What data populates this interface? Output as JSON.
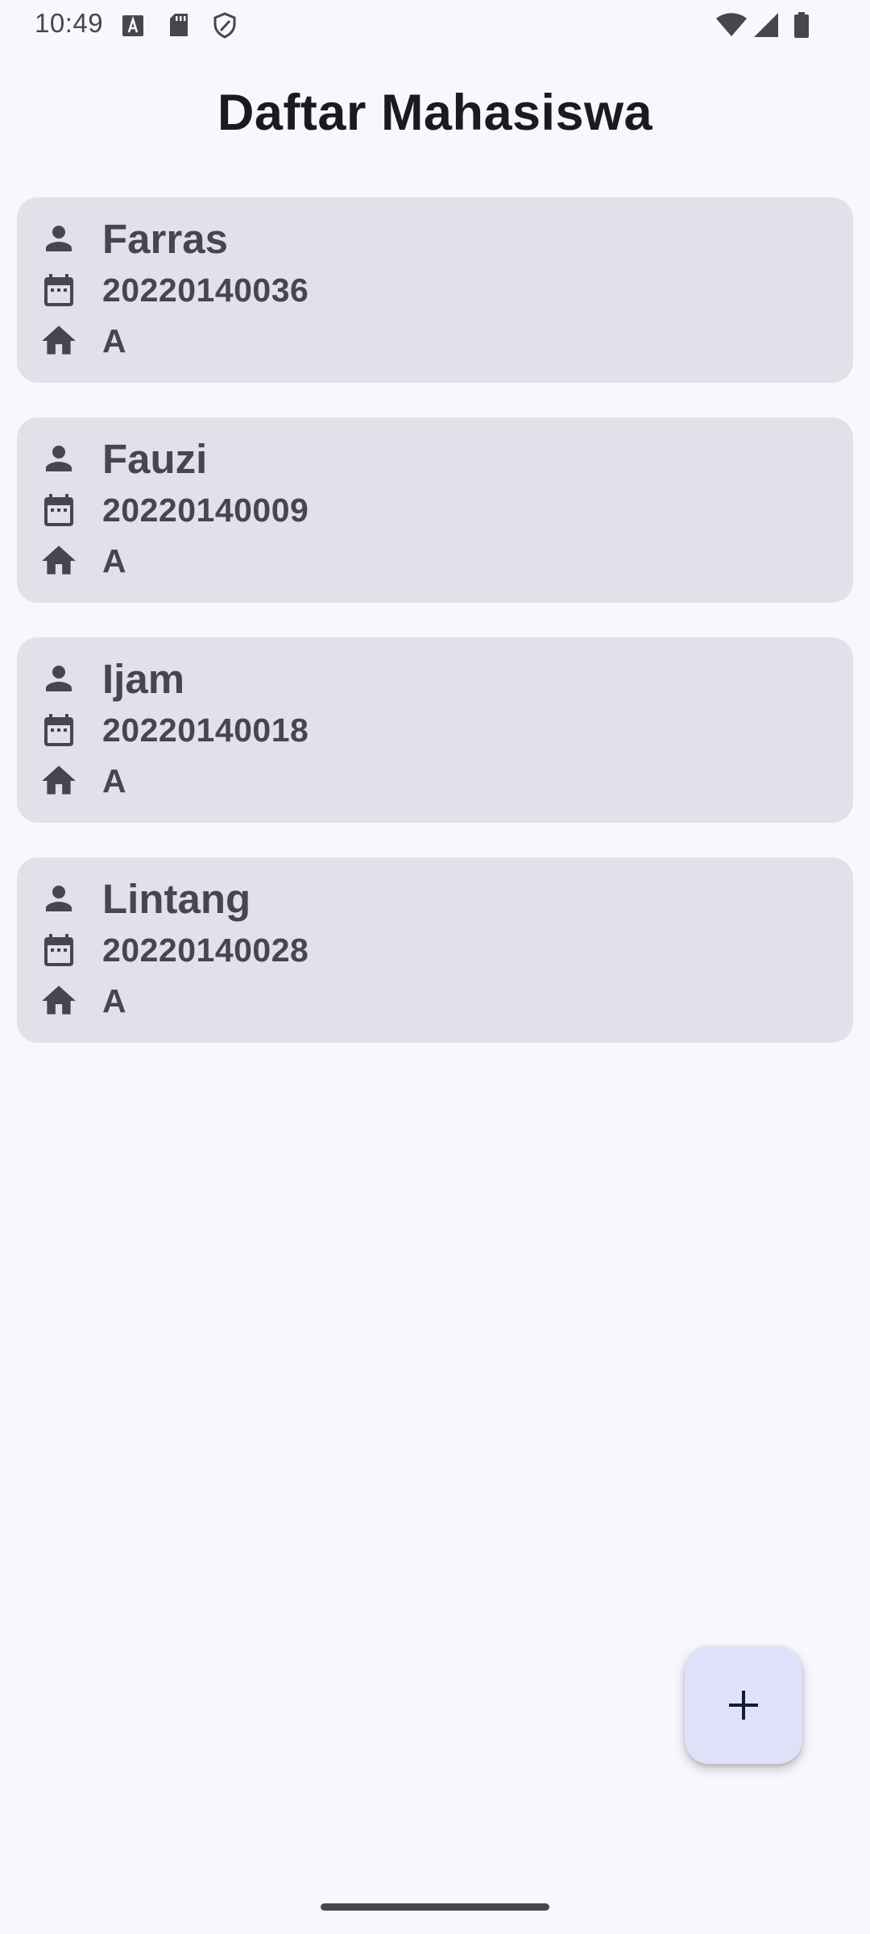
{
  "status_bar": {
    "time": "10:49",
    "icons": [
      "text-a-notification-icon",
      "sd-card-icon",
      "shield-icon",
      "wifi-icon",
      "cell-signal-icon",
      "battery-icon"
    ]
  },
  "page": {
    "title": "Daftar Mahasiswa"
  },
  "students": [
    {
      "name": "Farras",
      "nim": "20220140036",
      "class": "A"
    },
    {
      "name": "Fauzi",
      "nim": "20220140009",
      "class": "A"
    },
    {
      "name": "Ijam",
      "nim": "20220140018",
      "class": "A"
    },
    {
      "name": "Lintang",
      "nim": "20220140028",
      "class": "A"
    }
  ],
  "row_icons": {
    "name": "person-icon",
    "nim": "calendar-icon",
    "class": "home-icon"
  },
  "fab": {
    "icon": "add-icon"
  },
  "colors": {
    "background": "#f8f7fd",
    "card": "#e2e1ea",
    "card_text": "#46464f",
    "fab": "#dfe1f9"
  }
}
